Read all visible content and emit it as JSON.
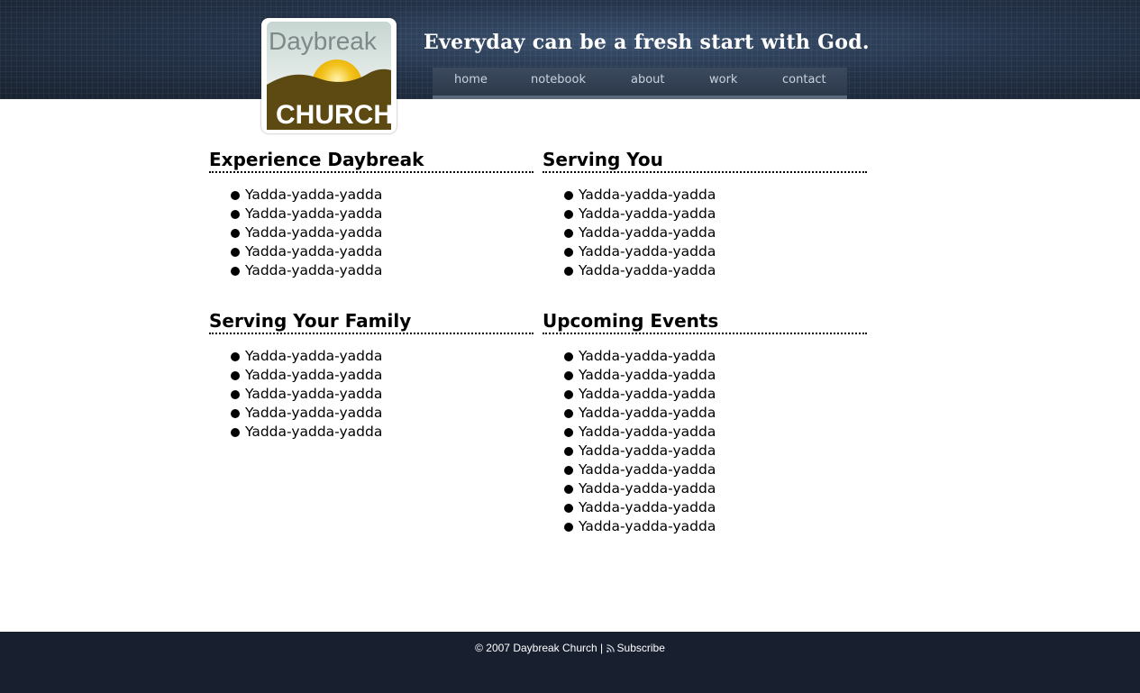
{
  "header": {
    "logo_text_top": "Daybreak",
    "logo_text_bottom": "CHURCH",
    "tagline": "Everyday can be a fresh start with God.",
    "nav": [
      {
        "label": "home"
      },
      {
        "label": "notebook"
      },
      {
        "label": "about"
      },
      {
        "label": "work"
      },
      {
        "label": "contact"
      }
    ]
  },
  "sections": [
    {
      "title": "Experience Daybreak",
      "items": [
        "Yadda-yadda-yadda",
        "Yadda-yadda-yadda",
        "Yadda-yadda-yadda",
        "Yadda-yadda-yadda",
        "Yadda-yadda-yadda"
      ]
    },
    {
      "title": "Serving You",
      "items": [
        "Yadda-yadda-yadda",
        "Yadda-yadda-yadda",
        "Yadda-yadda-yadda",
        "Yadda-yadda-yadda",
        "Yadda-yadda-yadda"
      ]
    },
    {
      "title": "Serving Your Family",
      "items": [
        "Yadda-yadda-yadda",
        "Yadda-yadda-yadda",
        "Yadda-yadda-yadda",
        "Yadda-yadda-yadda",
        "Yadda-yadda-yadda"
      ]
    },
    {
      "title": "Upcoming Events",
      "items": [
        "Yadda-yadda-yadda",
        "Yadda-yadda-yadda",
        "Yadda-yadda-yadda",
        "Yadda-yadda-yadda",
        "Yadda-yadda-yadda",
        "Yadda-yadda-yadda",
        "Yadda-yadda-yadda",
        "Yadda-yadda-yadda",
        "Yadda-yadda-yadda",
        "Yadda-yadda-yadda"
      ]
    }
  ],
  "footer": {
    "copyright": "© 2007 Daybreak Church",
    "separator": "|",
    "subscribe_label": "Subscribe",
    "rss_icon": "rss-icon"
  },
  "colors": {
    "header_bg": "#1d2a3e",
    "footer_bg": "#182030",
    "logo_brown": "#5c4a12",
    "logo_sun": "#f2c21b"
  }
}
